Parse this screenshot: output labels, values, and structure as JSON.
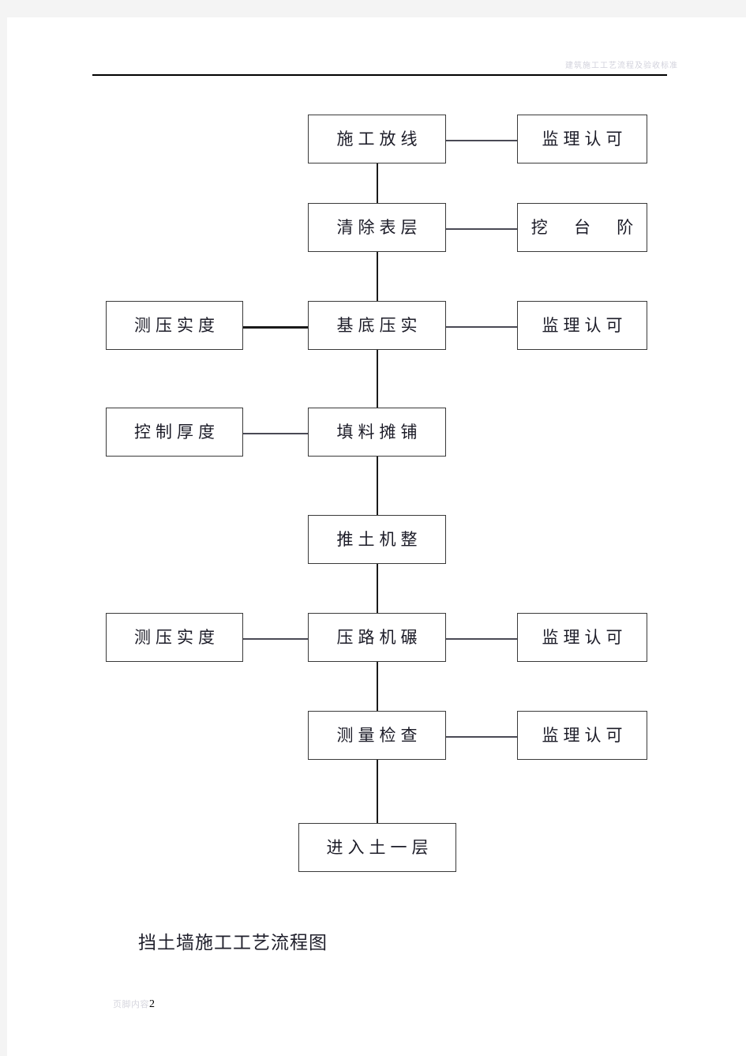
{
  "document": {
    "header_text": "建筑施工工艺流程及验收标准",
    "caption": "挡土墙施工工艺流程图",
    "footer_note": "页脚内容",
    "footer_page_number": "2"
  },
  "chart_data": {
    "type": "diagram",
    "title": "挡土墙施工工艺流程图",
    "nodes": [
      {
        "id": "n1",
        "label": "施工放线",
        "column": "main",
        "row": 1
      },
      {
        "id": "n1r",
        "label": "监理认可",
        "column": "right",
        "row": 1
      },
      {
        "id": "n2",
        "label": "清除表层",
        "column": "main",
        "row": 2
      },
      {
        "id": "n2r",
        "label": "挖 台 阶",
        "column": "right",
        "row": 2
      },
      {
        "id": "n3l",
        "label": "测压实度",
        "column": "left",
        "row": 3
      },
      {
        "id": "n3",
        "label": "基底压实",
        "column": "main",
        "row": 3
      },
      {
        "id": "n3r",
        "label": "监理认可",
        "column": "right",
        "row": 3
      },
      {
        "id": "n4l",
        "label": "控制厚度",
        "column": "left",
        "row": 4
      },
      {
        "id": "n4",
        "label": "填料摊铺",
        "column": "main",
        "row": 4
      },
      {
        "id": "n5",
        "label": "推土机整",
        "column": "main",
        "row": 5
      },
      {
        "id": "n6l",
        "label": "测压实度",
        "column": "left",
        "row": 6
      },
      {
        "id": "n6",
        "label": "压路机碾",
        "column": "main",
        "row": 6
      },
      {
        "id": "n6r",
        "label": "监理认可",
        "column": "right",
        "row": 6
      },
      {
        "id": "n7",
        "label": "测量检查",
        "column": "main",
        "row": 7
      },
      {
        "id": "n7r",
        "label": "监理认可",
        "column": "right",
        "row": 7
      },
      {
        "id": "n8",
        "label": "进入土一层",
        "column": "main",
        "row": 8
      }
    ],
    "edges": [
      {
        "from": "n1",
        "to": "n1r",
        "direction": "horizontal"
      },
      {
        "from": "n1",
        "to": "n2",
        "direction": "vertical"
      },
      {
        "from": "n2",
        "to": "n2r",
        "direction": "horizontal"
      },
      {
        "from": "n2",
        "to": "n3",
        "direction": "vertical"
      },
      {
        "from": "n3l",
        "to": "n3",
        "direction": "horizontal"
      },
      {
        "from": "n3",
        "to": "n3r",
        "direction": "horizontal"
      },
      {
        "from": "n3",
        "to": "n4",
        "direction": "vertical"
      },
      {
        "from": "n4l",
        "to": "n4",
        "direction": "horizontal"
      },
      {
        "from": "n4",
        "to": "n5",
        "direction": "vertical"
      },
      {
        "from": "n5",
        "to": "n6",
        "direction": "vertical"
      },
      {
        "from": "n6l",
        "to": "n6",
        "direction": "horizontal"
      },
      {
        "from": "n6",
        "to": "n6r",
        "direction": "horizontal"
      },
      {
        "from": "n6",
        "to": "n7",
        "direction": "vertical"
      },
      {
        "from": "n7",
        "to": "n7r",
        "direction": "horizontal"
      },
      {
        "from": "n7",
        "to": "n8",
        "direction": "vertical"
      }
    ]
  }
}
